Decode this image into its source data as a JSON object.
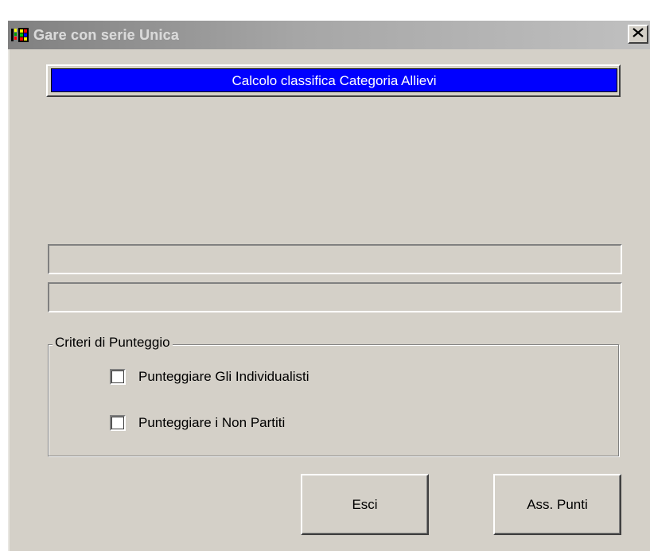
{
  "window": {
    "title": "Gare con serie Unica",
    "close_glyph": "✕",
    "icon": "app-grid-icon"
  },
  "header": {
    "text": "Calcolo classifica  Categoria Allievi",
    "background": "#0000ff",
    "color": "#ffffff"
  },
  "groupbox": {
    "legend": "Criteri di Punteggio",
    "options": [
      {
        "label": "Punteggiare Gli Individualisti",
        "checked": false
      },
      {
        "label": "Punteggiare i Non Partiti",
        "checked": false
      }
    ]
  },
  "buttons": {
    "exit_label": "Esci",
    "assign_label": "Ass. Punti"
  },
  "colors": {
    "face": "#d4d0c8",
    "titlebar_inactive": "#808080"
  }
}
